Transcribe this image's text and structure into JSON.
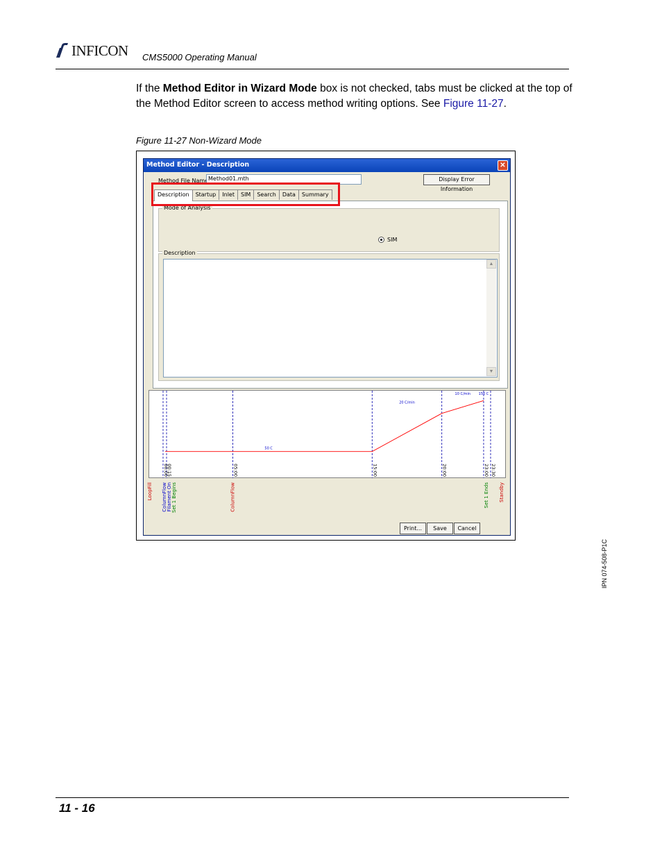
{
  "header": {
    "logo_text": "INFICON",
    "manual_title": "CMS5000 Operating Manual"
  },
  "body": {
    "para_before_bold": "If the ",
    "para_bold": "Method Editor in Wizard Mode",
    "para_after_bold": " box is not checked, tabs must be clicked at the top of the Method Editor screen to access method writing options. See ",
    "para_link": "Figure 11-27",
    "para_end": ".",
    "caption": "Figure 11-27  Non-Wizard Mode"
  },
  "window": {
    "title": "Method Editor - Description",
    "close_glyph": "✕",
    "file_label": "Method File Name:",
    "file_value": "Method01.mth",
    "error_button": "Display Error Information",
    "tabs": [
      "Description",
      "Startup",
      "Inlet",
      "SIM",
      "Search",
      "Data",
      "Summary"
    ],
    "group1_label": "Mode of Analysis",
    "radio_label": "SIM",
    "group2_label": "Description",
    "scroll_up": "▲",
    "scroll_down": "▼",
    "buttons": {
      "print": "Print...",
      "save": "Save",
      "cancel": "Cancel"
    }
  },
  "chart_data": {
    "type": "line",
    "series": [
      {
        "x": [
          0.15,
          15.0,
          20.0,
          23.0
        ],
        "values": [
          50,
          50,
          200,
          250
        ]
      }
    ],
    "time_labels": [
      "00:00",
      "00:15",
      "05:00",
      "15:00",
      "20:00",
      "23:00",
      "23:30"
    ],
    "segment_labels": [
      "50 C",
      "20 C/min",
      "10 C/min",
      "150 C"
    ],
    "event_labels": [
      {
        "text": "LoopFill",
        "color": "#cc0000"
      },
      {
        "text": "ColumnFlow",
        "color": "#0000cc"
      },
      {
        "text": "Filament On",
        "color": "#0000cc"
      },
      {
        "text": "Set 1 Begins",
        "color": "#008000"
      },
      {
        "text": "ColumnFlow",
        "color": "#cc0000"
      },
      {
        "text": "Set 1 Ends",
        "color": "#008000"
      },
      {
        "text": "Standby",
        "color": "#cc0000"
      }
    ],
    "line_color": "#ff0000"
  },
  "highlight_color": "#e8141c",
  "side_note": "IPN 074-508-P1C",
  "footer": {
    "page_number": "11 - 16"
  }
}
